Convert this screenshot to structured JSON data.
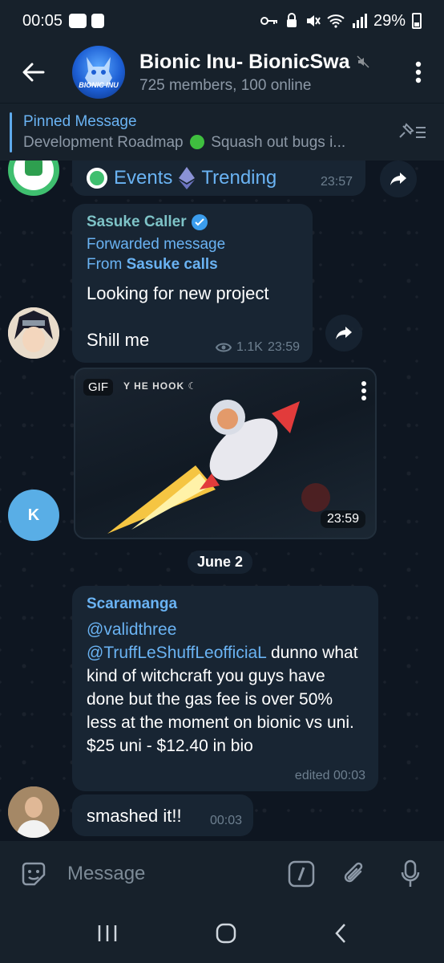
{
  "status_bar": {
    "time": "00:05",
    "battery": "29%"
  },
  "header": {
    "title": "Bionic Inu- BionicSwa",
    "subtitle": "725 members, 100 online",
    "avatar_text": "BIONIC INU"
  },
  "pinned": {
    "title": "Pinned Message",
    "body_prefix": "Development Roadmap",
    "body_suffix": "Squash out bugs i..."
  },
  "messages": [
    {
      "row": [
        {
          "label": "Events"
        },
        {
          "label": "Trending"
        }
      ],
      "time": "23:57"
    },
    {
      "sender": "Sasuke Caller",
      "forwarded_label": "Forwarded message",
      "from_prefix": "From",
      "from_name": "Sasuke calls",
      "text_1": "Looking for new project",
      "text_2": "Shill me",
      "views": "1.1K",
      "time": "23:59"
    },
    {
      "gif_badge": "GIF",
      "gif_caption": "Y HE HOOK ☾",
      "time": "23:59",
      "avatar_letter": "K"
    },
    {
      "sender": "Scaramanga",
      "mention_1": "@validthree",
      "mention_2": "@TruffLeShuffLeofficiaL",
      "text": "dunno what kind of witchcraft you guys have done but the gas fee is over 50% less at the moment on bionic vs uni. $25 uni - $12.40 in bio",
      "meta": "edited 00:03"
    },
    {
      "text": "smashed it!!",
      "time": "00:03"
    }
  ],
  "date_separator": "June 2",
  "input": {
    "placeholder": "Message"
  },
  "colors": {
    "accent": "#6ab3f3",
    "bubble": "#182533",
    "background": "#0e1621",
    "bar": "#17212b"
  }
}
